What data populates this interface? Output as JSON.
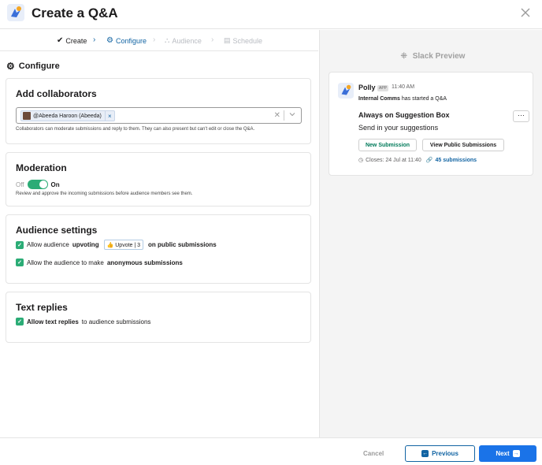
{
  "header": {
    "title": "Create a Q&A",
    "close_icon": "close-icon"
  },
  "steps": [
    {
      "label": "Create",
      "state": "done"
    },
    {
      "label": "Configure",
      "state": "current"
    },
    {
      "label": "Audience",
      "state": "disabled"
    },
    {
      "label": "Schedule",
      "state": "disabled"
    }
  ],
  "section_title": "Configure",
  "collaborators": {
    "heading": "Add collaborators",
    "chip_label": "@Abeeda Haroon (Abeeda)",
    "chip_remove": "×",
    "clear": "✕",
    "help": "Collaborators can moderate submissions and reply to them. They can also present but can't edit or close the Q&A."
  },
  "moderation": {
    "heading": "Moderation",
    "off_label": "Off",
    "on_label": "On",
    "enabled": true,
    "help": "Review and approve the incoming submissions before audience members see them."
  },
  "audience_settings": {
    "heading": "Audience settings",
    "upvoting_pre": "Allow audience",
    "upvoting_bold": "upvoting",
    "upvote_chip": "👍 Upvote | 3",
    "upvoting_post": "on public submissions",
    "anon_pre": "Allow the audience to make",
    "anon_bold": "anonymous submissions"
  },
  "text_replies": {
    "heading": "Text replies",
    "pre": "Allow text replies",
    "post": "to audience submissions"
  },
  "preview": {
    "title": "Slack Preview",
    "bot_name": "Polly",
    "app_badge": "APP",
    "time": "11:40 AM",
    "line_bold": "Internal Comms",
    "line_rest": "has started a Q&A",
    "qa_title": "Always on Suggestion Box",
    "qa_sub": "Send in your suggestions",
    "more": "···",
    "btn_new": "New Submission",
    "btn_view": "View Public Submissions",
    "closes": "Closes: 24 Jul at 11:40",
    "submissions": "45 submissions"
  },
  "footer": {
    "cancel": "Cancel",
    "previous": "Previous",
    "next": "Next"
  },
  "colors": {
    "accent": "#1264a3",
    "primary_button": "#1a73e8",
    "toggle_on": "#2bac76"
  }
}
